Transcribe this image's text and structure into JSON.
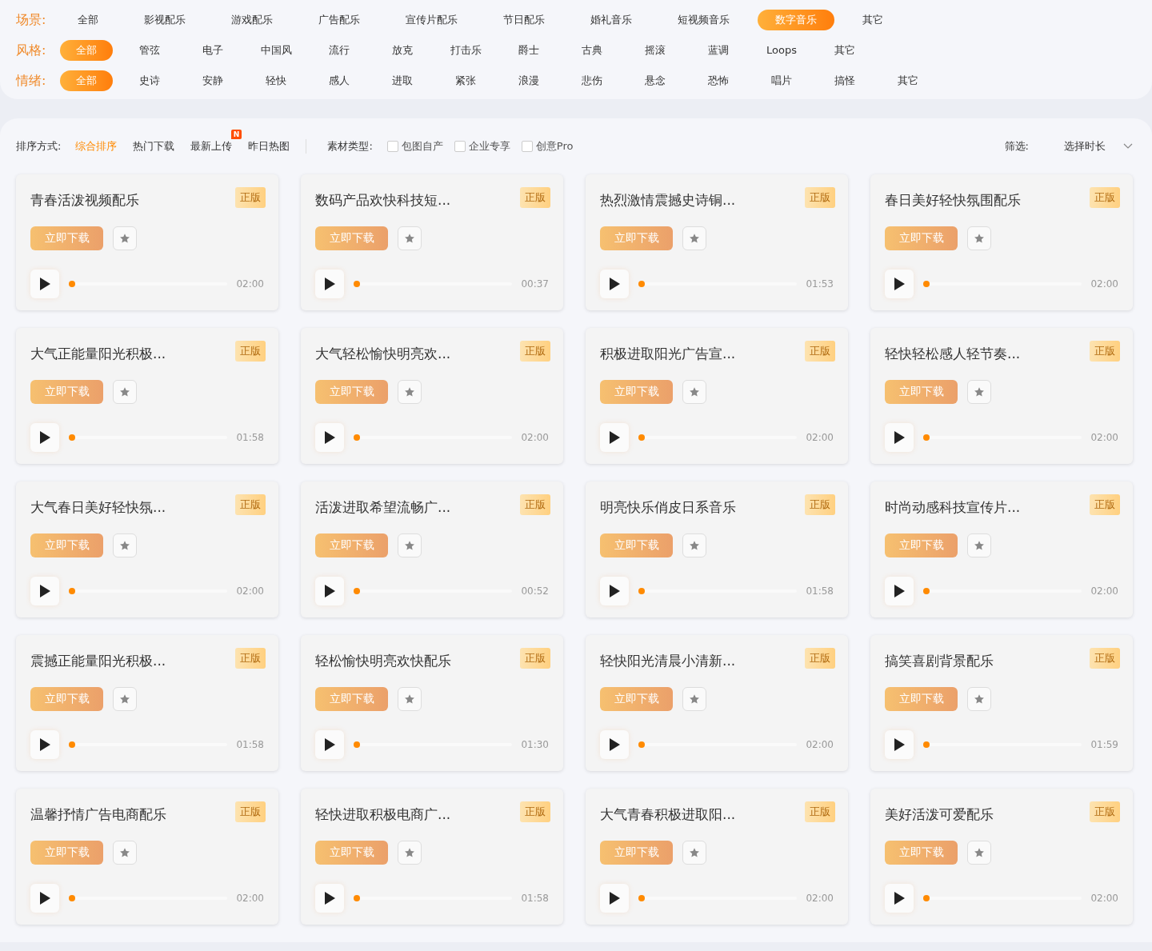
{
  "filters": [
    {
      "label": "场景:",
      "options": [
        {
          "text": "全部",
          "selected": false
        },
        {
          "text": "影视配乐",
          "selected": false
        },
        {
          "text": "游戏配乐",
          "selected": false
        },
        {
          "text": "广告配乐",
          "selected": false
        },
        {
          "text": "宣传片配乐",
          "selected": false
        },
        {
          "text": "节日配乐",
          "selected": false
        },
        {
          "text": "婚礼音乐",
          "selected": false
        },
        {
          "text": "短视频音乐",
          "selected": false
        },
        {
          "text": "数字音乐",
          "selected": true
        },
        {
          "text": "其它",
          "selected": false
        }
      ]
    },
    {
      "label": "风格:",
      "options": [
        {
          "text": "全部",
          "selected": true
        },
        {
          "text": "管弦",
          "selected": false
        },
        {
          "text": "电子",
          "selected": false
        },
        {
          "text": "中国风",
          "selected": false
        },
        {
          "text": "流行",
          "selected": false
        },
        {
          "text": "放克",
          "selected": false
        },
        {
          "text": "打击乐",
          "selected": false
        },
        {
          "text": "爵士",
          "selected": false
        },
        {
          "text": "古典",
          "selected": false
        },
        {
          "text": "摇滚",
          "selected": false
        },
        {
          "text": "蓝调",
          "selected": false
        },
        {
          "text": "Loops",
          "selected": false
        },
        {
          "text": "其它",
          "selected": false
        }
      ]
    },
    {
      "label": "情绪:",
      "options": [
        {
          "text": "全部",
          "selected": true
        },
        {
          "text": "史诗",
          "selected": false
        },
        {
          "text": "安静",
          "selected": false
        },
        {
          "text": "轻快",
          "selected": false
        },
        {
          "text": "感人",
          "selected": false
        },
        {
          "text": "进取",
          "selected": false
        },
        {
          "text": "紧张",
          "selected": false
        },
        {
          "text": "浪漫",
          "selected": false
        },
        {
          "text": "悲伤",
          "selected": false
        },
        {
          "text": "悬念",
          "selected": false
        },
        {
          "text": "恐怖",
          "selected": false
        },
        {
          "text": "唱片",
          "selected": false
        },
        {
          "text": "搞怪",
          "selected": false
        },
        {
          "text": "其它",
          "selected": false
        }
      ]
    }
  ],
  "toolbar": {
    "sort_label": "排序方式:",
    "sort_options": [
      {
        "text": "综合排序",
        "selected": true
      },
      {
        "text": "热门下载",
        "selected": false
      },
      {
        "text": "最新上传",
        "selected": false,
        "badge": "N"
      },
      {
        "text": "昨日热图",
        "selected": false
      }
    ],
    "type_label": "素材类型:",
    "types": [
      {
        "text": "包图自产",
        "checked": false
      },
      {
        "text": "企业专享",
        "checked": false
      },
      {
        "text": "创意Pro",
        "checked": false
      }
    ],
    "filter_label": "筛选:",
    "duration_select": "选择时长"
  },
  "tracks": [
    {
      "title": "青春活泼视频配乐",
      "badge": "正版",
      "button": "立即下载",
      "duration": "02:00",
      "level": 0
    },
    {
      "title": "数码产品欢快科技短...",
      "badge": "正版",
      "button": "立即下载",
      "duration": "00:37",
      "level": 0
    },
    {
      "title": "热烈激情震撼史诗铜...",
      "badge": "正版",
      "button": "立即下载",
      "duration": "01:53",
      "level": 0
    },
    {
      "title": "春日美好轻快氛围配乐",
      "badge": "正版",
      "button": "立即下载",
      "duration": "02:00",
      "level": 0
    },
    {
      "title": "大气正能量阳光积极...",
      "badge": "正版",
      "button": "立即下载",
      "duration": "01:58",
      "level": 0
    },
    {
      "title": "大气轻松愉快明亮欢...",
      "badge": "正版",
      "button": "立即下载",
      "duration": "02:00",
      "level": 0
    },
    {
      "title": "积极进取阳光广告宣...",
      "badge": "正版",
      "button": "立即下载",
      "duration": "02:00",
      "level": 0
    },
    {
      "title": "轻快轻松感人轻节奏...",
      "badge": "正版",
      "button": "立即下载",
      "duration": "02:00",
      "level": 0
    },
    {
      "title": "大气春日美好轻快氛...",
      "badge": "正版",
      "button": "立即下载",
      "duration": "02:00",
      "level": 0
    },
    {
      "title": "活泼进取希望流畅广...",
      "badge": "正版",
      "button": "立即下载",
      "duration": "00:52",
      "level": 0
    },
    {
      "title": "明亮快乐俏皮日系音乐",
      "badge": "正版",
      "button": "立即下载",
      "duration": "01:58",
      "level": 0
    },
    {
      "title": "时尚动感科技宣传片...",
      "badge": "正版",
      "button": "立即下载",
      "duration": "02:00",
      "level": 0
    },
    {
      "title": "震撼正能量阳光积极...",
      "badge": "正版",
      "button": "立即下载",
      "duration": "01:58",
      "level": 0
    },
    {
      "title": "轻松愉快明亮欢快配乐",
      "badge": "正版",
      "button": "立即下载",
      "duration": "01:30",
      "level": 0
    },
    {
      "title": "轻快阳光清晨小清新...",
      "badge": "正版",
      "button": "立即下载",
      "duration": "02:00",
      "level": 0
    },
    {
      "title": "搞笑喜剧背景配乐",
      "badge": "正版",
      "button": "立即下载",
      "duration": "01:59",
      "level": 0
    },
    {
      "title": "温馨抒情广告电商配乐",
      "badge": "正版",
      "button": "立即下载",
      "duration": "02:00",
      "level": 0
    },
    {
      "title": "轻快进取积极电商广...",
      "badge": "正版",
      "button": "立即下载",
      "duration": "01:58",
      "level": 0
    },
    {
      "title": "大气青春积极进取阳...",
      "badge": "正版",
      "button": "立即下载",
      "duration": "02:00",
      "level": 0
    },
    {
      "title": "美好活泼可爱配乐",
      "badge": "正版",
      "button": "立即下载",
      "duration": "02:00",
      "level": 0
    }
  ]
}
